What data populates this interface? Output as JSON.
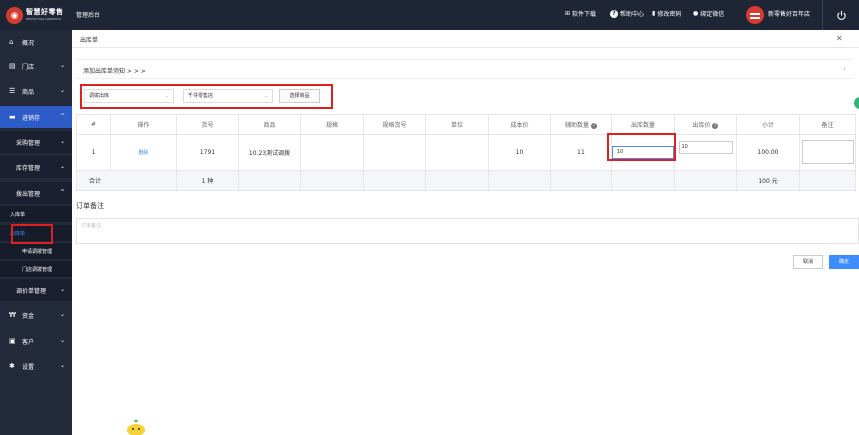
{
  "app": {
    "brand": "智慧好零售",
    "brand_sub": "ZHIHUI HAO LINGSHOU",
    "section": "管理后台"
  },
  "topbar": {
    "software": "软件下载",
    "help": "帮助中心",
    "change_pwd": "修改密码",
    "bind_wechat": "绑定微信",
    "store_name": "新零售好百年店"
  },
  "sidebar": {
    "overview": "概况",
    "store": "门店",
    "goods": "商品",
    "inventory": "进销存",
    "purchase": "采购管理",
    "stock": "库存管理",
    "transfer": "拨出管理",
    "in_order": "入库单",
    "out_order": "出库单",
    "apply_transfer": "申请调拨管理",
    "store_transfer": "门店调拨管理",
    "price_adjust": "调价单管理",
    "funds": "资金",
    "customer": "客户",
    "settings": "设置"
  },
  "page": {
    "title": "出库单",
    "notice": "添加出库单须知 > > >",
    "type_select": "调拨出库",
    "store_select": "千寻零售店",
    "choose_goods": "选择商品",
    "order_remark_title": "订单备注",
    "order_remark_placeholder": "订单备注",
    "cancel": "取消",
    "confirm": "确定"
  },
  "table": {
    "headers": [
      "#",
      "操作",
      "货号",
      "商品",
      "规格",
      "规格货号",
      "单位",
      "成本价",
      "辅助数量",
      "出库数量",
      "出库价",
      "小计",
      "备注"
    ],
    "row": {
      "index": "1",
      "action": "删除",
      "sku": "1791",
      "name": "10.23测试调拨",
      "spec": "",
      "spec_sku": "",
      "unit": "",
      "cost": "10",
      "aux_qty": "11",
      "out_qty": "10",
      "out_price": "10",
      "subtotal": "100.00"
    },
    "total": {
      "label": "合计",
      "kinds": "1 种",
      "amount": "100 元"
    }
  },
  "colors": {
    "sidebar": "#232a3a",
    "topbar": "#1e2534",
    "accent": "#3c8dff",
    "highlight": "#e02020",
    "active": "#2d5cc9"
  }
}
